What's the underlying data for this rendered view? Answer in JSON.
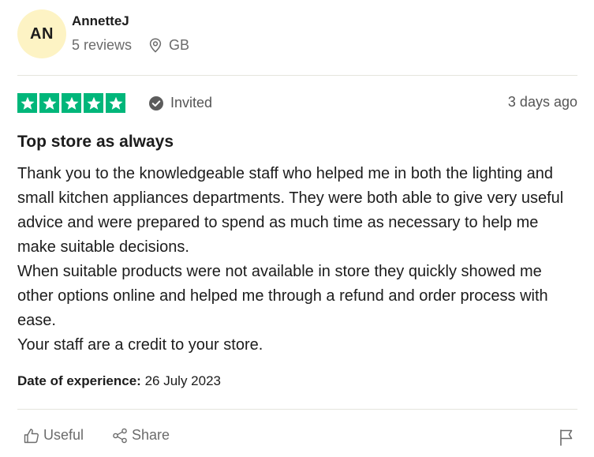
{
  "user": {
    "initials": "AN",
    "name": "AnnetteJ",
    "reviews": "5 reviews",
    "country": "GB"
  },
  "review": {
    "rating": 5,
    "status": "Invited",
    "posted": "3 days ago",
    "title": "Top store as always",
    "body": "Thank you to the knowledgeable staff who helped me in both the lighting and small kitchen appliances departments. They were both able to give very useful advice and were prepared to spend as much time as necessary to help me make suitable decisions.\nWhen suitable products were not available in store they quickly showed me other options online and helped me through a refund and order process with ease.\nYour staff are a credit to your store.",
    "experience_label": "Date of experience:",
    "experience_date": "26 July 2023"
  },
  "actions": {
    "useful": "Useful",
    "share": "Share"
  },
  "icons": [
    "location-pin-icon",
    "star-icon",
    "check-circle-icon",
    "thumbs-up-icon",
    "share-icon",
    "flag-icon"
  ],
  "colors": {
    "star_green": "#00b67a",
    "avatar_bg": "#fdf3c4",
    "muted_text": "#6b6b6b"
  }
}
